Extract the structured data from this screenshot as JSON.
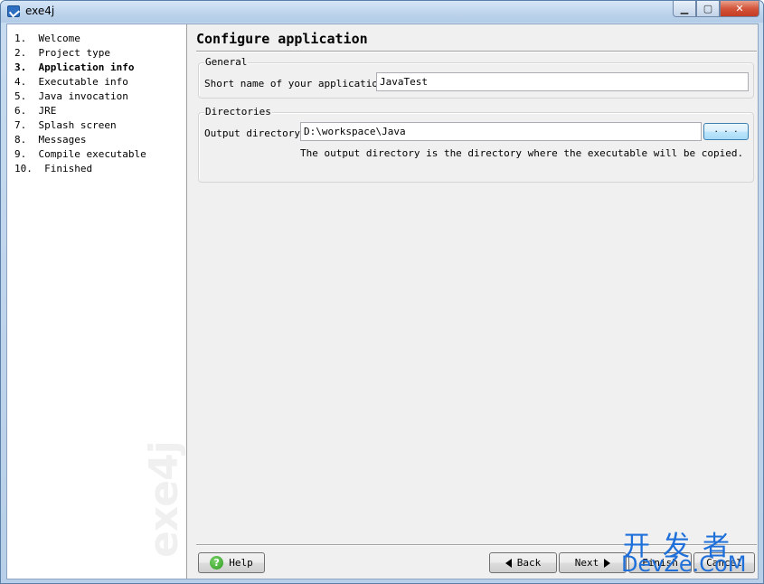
{
  "window": {
    "title": "exe4j",
    "controls": {
      "minimize": "▁",
      "maximize": "▢",
      "close": "✕"
    }
  },
  "sidebar": {
    "steps": [
      {
        "label": "1.  Welcome"
      },
      {
        "label": "2.  Project type"
      },
      {
        "label": "3.  Application info",
        "active": true
      },
      {
        "label": "4.  Executable info"
      },
      {
        "label": "5.  Java invocation"
      },
      {
        "label": "6.  JRE"
      },
      {
        "label": "7.  Splash screen"
      },
      {
        "label": "8.  Messages"
      },
      {
        "label": "9.  Compile executable"
      },
      {
        "label": "10.  Finished"
      }
    ],
    "watermark": "exe4j"
  },
  "main": {
    "title": "Configure application",
    "general": {
      "legend": "General",
      "short_name_label": "Short name of your application:",
      "short_name_value": "JavaTest"
    },
    "directories": {
      "legend": "Directories",
      "output_label": "Output directory:",
      "output_value": "D:\\workspace\\Java",
      "browse_label": ". . .",
      "hint": "The output directory is the directory where the executable will be copied."
    }
  },
  "buttons": {
    "help": "Help",
    "back": "Back",
    "next": "Next",
    "finish": "Finish",
    "cancel": "Cancel"
  },
  "overlay": {
    "brand_cn": "开发者",
    "brand_en": "DevZe.CoM"
  },
  "colors": {
    "accent": "#1e6fd9",
    "titlebar": "#bcd3ec",
    "dialog_bg": "#f0f0f0"
  }
}
